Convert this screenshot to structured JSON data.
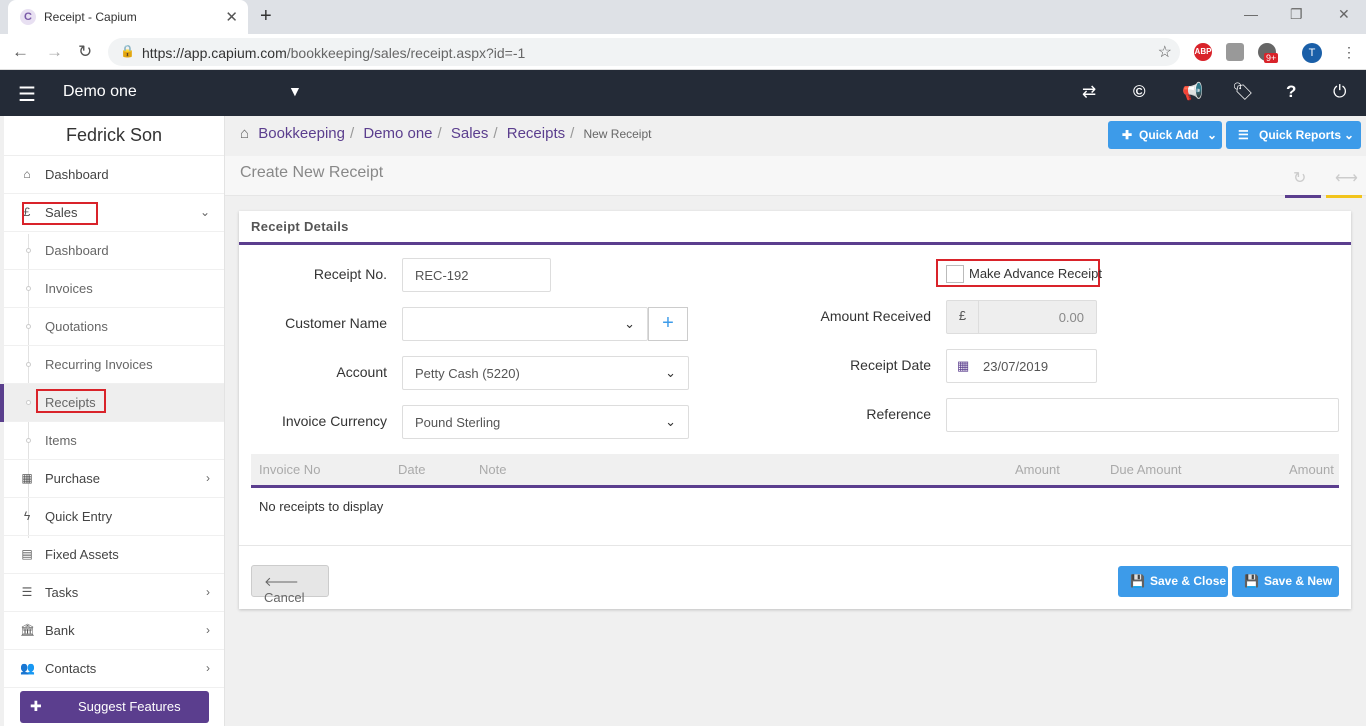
{
  "browser": {
    "tab_title": "Receipt - Capium",
    "tab_favicon": "C",
    "url_host": "https://app.capium.com",
    "url_path": "/bookkeeping/sales/receipt.aspx?id=-1",
    "ext_abp": "ABP",
    "ext_badge": "9+",
    "profile_initial": "T"
  },
  "header": {
    "company": "Demo one"
  },
  "sidebar": {
    "user": "Fedrick Son",
    "items": [
      {
        "label": "Dashboard"
      },
      {
        "label": "Sales"
      },
      {
        "label": "Dashboard"
      },
      {
        "label": "Invoices"
      },
      {
        "label": "Quotations"
      },
      {
        "label": "Recurring Invoices"
      },
      {
        "label": "Receipts"
      },
      {
        "label": "Items"
      },
      {
        "label": "Purchase"
      },
      {
        "label": "Quick Entry"
      },
      {
        "label": "Fixed Assets"
      },
      {
        "label": "Tasks"
      },
      {
        "label": "Bank"
      },
      {
        "label": "Contacts"
      }
    ],
    "suggest": "Suggest Features"
  },
  "breadcrumb": {
    "items": [
      "Bookkeeping",
      "Demo one",
      "Sales",
      "Receipts"
    ],
    "current": "New Receipt"
  },
  "toolbar": {
    "quick_add": "Quick Add",
    "quick_reports": "Quick Reports"
  },
  "page": {
    "title": "Create New Receipt"
  },
  "form": {
    "section_title": "Receipt Details",
    "receipt_no_label": "Receipt No.",
    "receipt_no_value": "REC-192",
    "customer_label": "Customer Name",
    "customer_value": "",
    "account_label": "Account",
    "account_value": "Petty Cash (5220)",
    "currency_label": "Invoice Currency",
    "currency_value": "Pound Sterling",
    "advance_label": "Make Advance Receipt",
    "amount_label": "Amount Received",
    "amount_symbol": "£",
    "amount_value": "0.00",
    "date_label": "Receipt Date",
    "date_value": "23/07/2019",
    "reference_label": "Reference",
    "reference_value": ""
  },
  "table": {
    "columns": [
      "Invoice No",
      "Date",
      "Note",
      "Amount",
      "Due Amount",
      "Amount"
    ],
    "empty": "No receipts to display"
  },
  "actions": {
    "cancel": "Cancel",
    "save_close": "Save & Close",
    "save_new": "Save & New"
  },
  "colors": {
    "accent": "#5b3e8e",
    "button_blue": "#3d9be9",
    "header_bg": "#242b37",
    "highlight_red": "#d9232a"
  }
}
